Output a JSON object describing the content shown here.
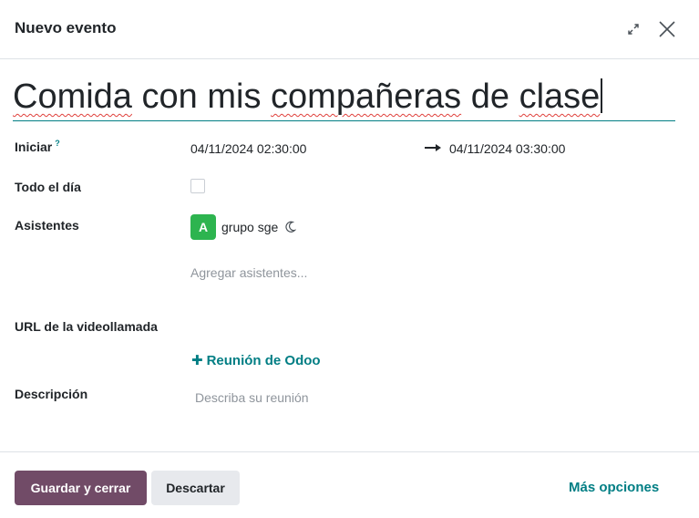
{
  "dialog": {
    "title": "Nuevo evento",
    "expand_icon": "expand-icon",
    "close_icon": "close-icon"
  },
  "event": {
    "name_words": [
      "Comida",
      "con",
      "mis",
      "compañeras",
      "de",
      "clase"
    ]
  },
  "fields": {
    "start": {
      "label": "Iniciar",
      "help": "?",
      "start_value": "04/11/2024 02:30:00",
      "end_value": "04/11/2024 03:30:00",
      "arrow_icon": "arrow-right-icon"
    },
    "allday": {
      "label": "Todo el día",
      "checked": false
    },
    "attendees": {
      "label": "Asistentes",
      "items": [
        {
          "initial": "A",
          "name": "grupo sge",
          "status_icon": "moon-icon",
          "avatar_color": "#2db44f"
        }
      ],
      "add_placeholder": "Agregar asistentes..."
    },
    "videocall": {
      "label": "URL de la videollamada",
      "action_label": "Reunión de Odoo",
      "action_icon": "plus-icon"
    },
    "description": {
      "label": "Descripción",
      "placeholder": "Describa su reunión"
    }
  },
  "footer": {
    "save_label": "Guardar y cerrar",
    "discard_label": "Descartar",
    "more_label": "Más opciones"
  },
  "colors": {
    "primary": "#714b67",
    "accent": "#017e84",
    "secondary_bg": "#e7e9ed"
  }
}
